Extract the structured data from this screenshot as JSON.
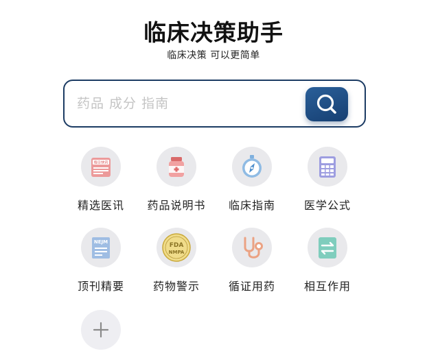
{
  "header": {
    "title": "临床决策助手",
    "subtitle": "临床决策 可以更简单"
  },
  "search": {
    "placeholder": "药品 成分 指南"
  },
  "tiles": [
    {
      "label": "精选医讯",
      "icon": "newspaper-icon",
      "badge_text": "每日快讯",
      "color": "#e07a7a"
    },
    {
      "label": "药品说明书",
      "icon": "medicine-bottle-icon",
      "color": "#e06e6e"
    },
    {
      "label": "临床指南",
      "icon": "compass-icon",
      "color": "#5a9bd5"
    },
    {
      "label": "医学公式",
      "icon": "calculator-icon",
      "color": "#8a8ad6"
    },
    {
      "label": "顶刊精要",
      "icon": "journal-icon",
      "badge_text": "NEJM",
      "color": "#7aa0d0"
    },
    {
      "label": "药物警示",
      "icon": "fda-seal-icon",
      "badge_text": "FDA NMPA",
      "color": "#e3c75a"
    },
    {
      "label": "循证用药",
      "icon": "stethoscope-icon",
      "color": "#e89a78"
    },
    {
      "label": "相互作用",
      "icon": "swap-icon",
      "color": "#5fbcaa"
    },
    {
      "label": "",
      "icon": "add-icon",
      "color": "#999999"
    }
  ]
}
